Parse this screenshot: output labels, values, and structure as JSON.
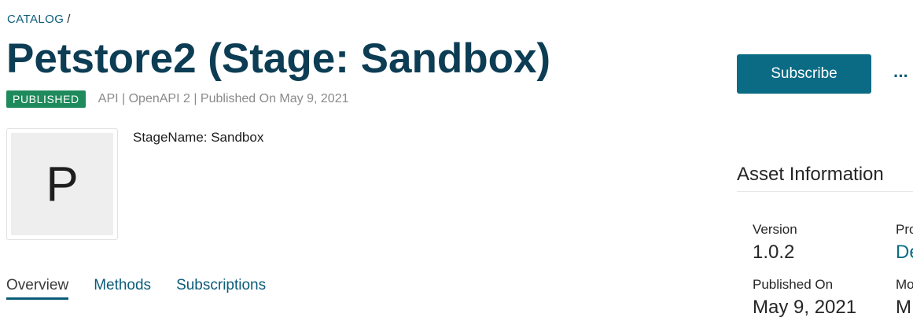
{
  "breadcrumb": {
    "root": "CATALOG",
    "separator": "/"
  },
  "header": {
    "title": "Petstore2 (Stage: Sandbox)",
    "status_badge": "PUBLISHED",
    "meta": "API | OpenAPI 2 | Published On May 9, 2021"
  },
  "thumbnail": {
    "letter": "P"
  },
  "description": "StageName: Sandbox",
  "tabs": [
    {
      "label": "Overview",
      "active": true
    },
    {
      "label": "Methods"
    },
    {
      "label": "Subscriptions"
    }
  ],
  "actions": {
    "subscribe_label": "Subscribe",
    "more_label": "···"
  },
  "asset_info": {
    "title": "Asset Information",
    "version_label": "Version",
    "version_value": "1.0.2",
    "published_label": "Published On",
    "published_value": "May 9, 2021",
    "col2_label_1": "Pro",
    "col2_value_1": "De",
    "col2_label_2": "Mo",
    "col2_value_2": "M"
  },
  "colors": {
    "primary": "#0b6b85",
    "title": "#0d3d54",
    "badge": "#1f8a5c"
  }
}
